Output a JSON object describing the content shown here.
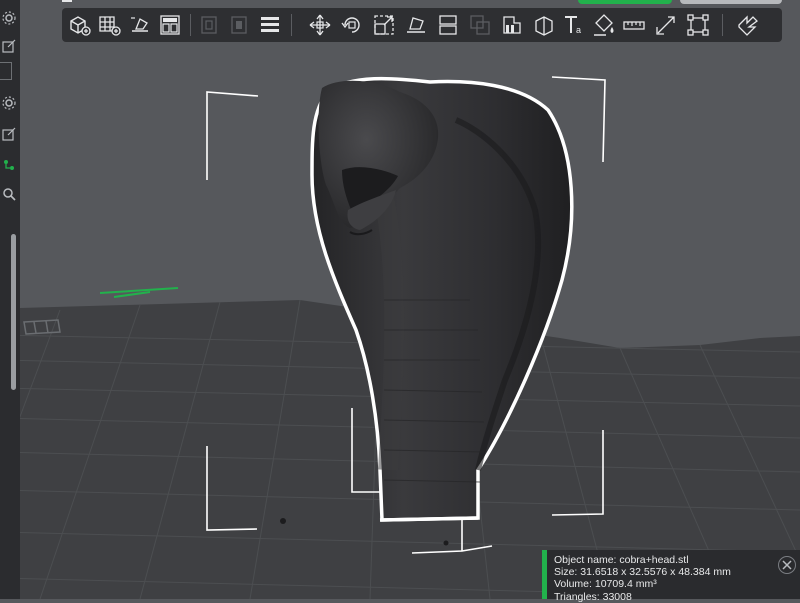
{
  "app": {
    "view": "3D prepare viewport",
    "accent_color": "#22b14c",
    "background_color": "#56585c",
    "plate_color": "#3f4043",
    "model_color": "#2c2c2e"
  },
  "left_rail": {
    "items": [
      {
        "icon": "gear-icon"
      },
      {
        "icon": "edit-icon"
      },
      {
        "icon": "gear-icon"
      },
      {
        "icon": "edit-icon"
      },
      {
        "icon": "objects-icon",
        "active": true
      },
      {
        "icon": "search-icon"
      }
    ]
  },
  "toolbar": {
    "tools": [
      {
        "icon": "add-object-icon"
      },
      {
        "icon": "add-plate-icon"
      },
      {
        "icon": "auto-orient-icon"
      },
      {
        "icon": "arrange-icon"
      },
      {
        "icon": "split-objects-icon",
        "disabled": true
      },
      {
        "icon": "split-parts-icon",
        "disabled": true
      },
      {
        "icon": "layers-icon"
      },
      {
        "icon": "move-icon"
      },
      {
        "icon": "rotate-icon"
      },
      {
        "icon": "scale-icon"
      },
      {
        "icon": "lay-on-face-icon"
      },
      {
        "icon": "cut-icon"
      },
      {
        "icon": "boolean-icon",
        "disabled": true
      },
      {
        "icon": "support-paint-icon"
      },
      {
        "icon": "seam-paint-icon"
      },
      {
        "icon": "text-emboss-icon"
      },
      {
        "icon": "color-paint-icon"
      },
      {
        "icon": "measure-icon"
      },
      {
        "icon": "assembly-icon"
      },
      {
        "icon": "bounding-box-icon"
      },
      {
        "icon": "explode-view-icon"
      }
    ]
  },
  "object_info": {
    "name_line": "Object name: cobra+head.stl",
    "size_line": "Size: 31.6518 x 32.5576 x 48.384 mm",
    "volume_line": "Volume: 10709.4 mm³",
    "triangles_line": "Triangles: 33008"
  }
}
